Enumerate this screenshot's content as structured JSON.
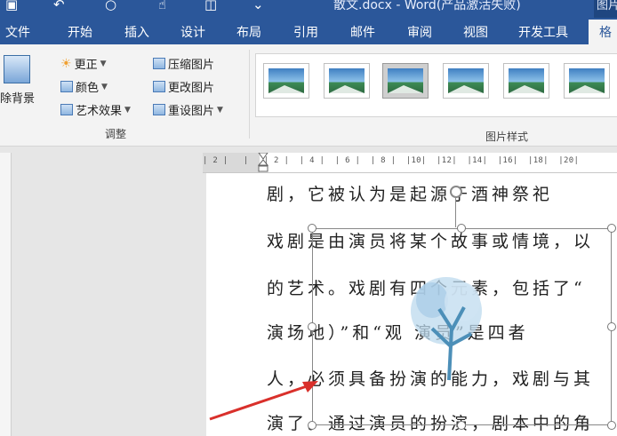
{
  "titlebar": {
    "title": "散文.docx - Word(产品激活失败)",
    "right_label": "图片",
    "quick_access": [
      "save-icon",
      "undo-icon",
      "redo-icon",
      "touch-mode-icon",
      "print-preview-icon",
      "customize-icon"
    ]
  },
  "tabs": [
    "文件",
    "开始",
    "插入",
    "设计",
    "布局",
    "引用",
    "邮件",
    "审阅",
    "视图",
    "开发工具",
    "格"
  ],
  "ribbon": {
    "remove_bg": "除背景",
    "corrections": "更正",
    "color": "颜色",
    "art_effects": "艺术效果",
    "compress": "压缩图片",
    "change_pic": "更改图片",
    "reset_pic": "重设图片",
    "adjust_group": "调整",
    "styles_group": "图片样式"
  },
  "ruler": {
    "numbers": "| 2 |   |   | 2 |  | 4 |  | 6 |  | 8 |  |10|  |12|  |14|  |16|  |18|  |20|"
  },
  "document": {
    "lines": [
      "剧，它被认为是起源于酒神祭祀",
      "戏剧是由演员将某个故事或情境，以",
      "的艺术。戏剧有四个元素，包括了“",
      "演场地）”和“观    演员”是四者",
      "人，必须具备扮演的能力，戏剧与其",
      "演了。通过演员的扮演，剧本中的角"
    ]
  },
  "colors": {
    "accent": "#2b579a",
    "arrow": "#d9302b"
  }
}
